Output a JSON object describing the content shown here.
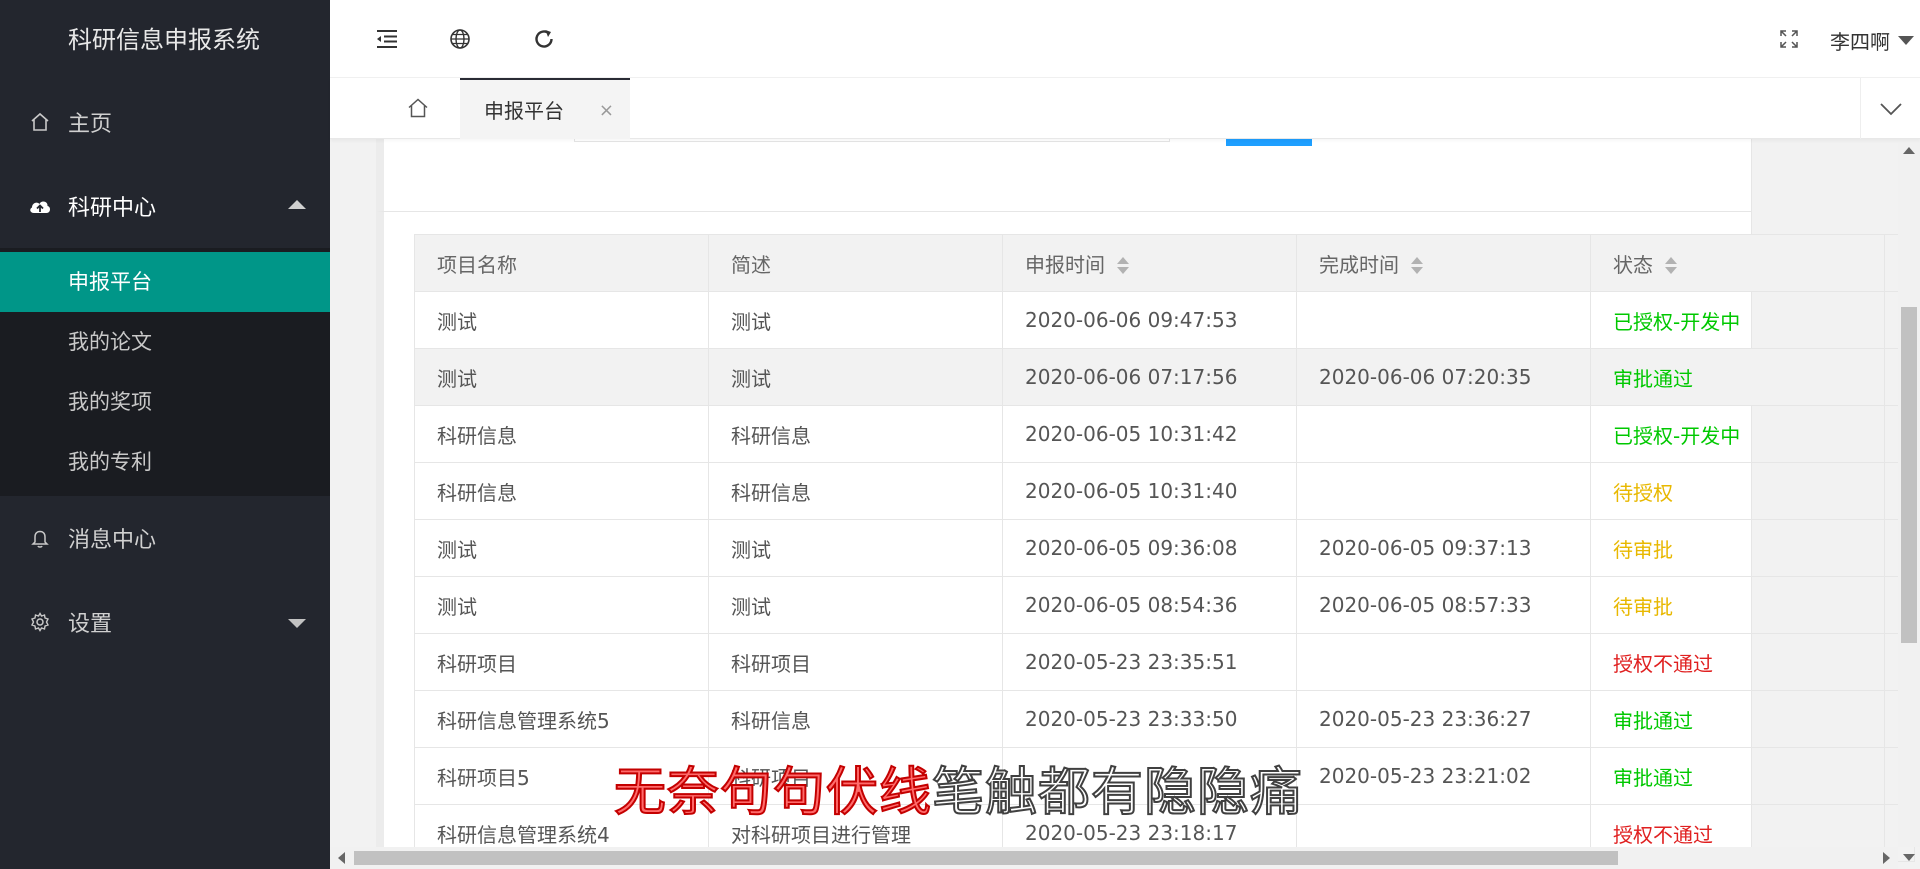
{
  "app": {
    "title": "科研信息申报系统"
  },
  "sidebar": {
    "home": "主页",
    "research": {
      "label": "科研中心",
      "items": [
        {
          "label": "申报平台"
        },
        {
          "label": "我的论文"
        },
        {
          "label": "我的奖项"
        },
        {
          "label": "我的专利"
        }
      ]
    },
    "messages": "消息中心",
    "settings": "设置"
  },
  "header": {
    "user": "李四啊",
    "icons": [
      "menu-indent-icon",
      "globe-icon",
      "refresh-icon",
      "fullscreen-icon"
    ]
  },
  "tabs": {
    "active": "申报平台",
    "close_symbol": "×"
  },
  "table": {
    "columns": [
      "项目名称",
      "简述",
      "申报时间",
      "完成时间",
      "状态"
    ],
    "sortable": [
      false,
      false,
      true,
      true,
      true
    ],
    "rows": [
      {
        "name": "测试",
        "desc": "测试",
        "submitted": "2020-06-06 09:47:53",
        "completed": "",
        "status": "已授权-开发中",
        "status_color": "#00c800"
      },
      {
        "name": "测试",
        "desc": "测试",
        "submitted": "2020-06-06 07:17:56",
        "completed": "2020-06-06 07:20:35",
        "status": "审批通过",
        "status_color": "#00c800"
      },
      {
        "name": "科研信息",
        "desc": "科研信息",
        "submitted": "2020-06-05 10:31:42",
        "completed": "",
        "status": "已授权-开发中",
        "status_color": "#00c800"
      },
      {
        "name": "科研信息",
        "desc": "科研信息",
        "submitted": "2020-06-05 10:31:40",
        "completed": "",
        "status": "待授权",
        "status_color": "#e8b800"
      },
      {
        "name": "测试",
        "desc": "测试",
        "submitted": "2020-06-05 09:36:08",
        "completed": "2020-06-05 09:37:13",
        "status": "待审批",
        "status_color": "#e8b800"
      },
      {
        "name": "测试",
        "desc": "测试",
        "submitted": "2020-06-05 08:54:36",
        "completed": "2020-06-05 08:57:33",
        "status": "待审批",
        "status_color": "#e8b800"
      },
      {
        "name": "科研项目",
        "desc": "科研项目",
        "submitted": "2020-05-23 23:35:51",
        "completed": "",
        "status": "授权不通过",
        "status_color": "#e02020"
      },
      {
        "name": "科研信息管理系统5",
        "desc": "科研信息",
        "submitted": "2020-05-23 23:33:50",
        "completed": "2020-05-23 23:36:27",
        "status": "审批通过",
        "status_color": "#00c800"
      },
      {
        "name": "科研项目5",
        "desc": "科研项目",
        "submitted": "",
        "completed": "2020-05-23 23:21:02",
        "status": "审批通过",
        "status_color": "#00c800"
      },
      {
        "name": "科研信息管理系统4",
        "desc": "对科研项目进行管理",
        "submitted": "2020-05-23 23:18:17",
        "completed": "",
        "status": "授权不通过",
        "status_color": "#e02020"
      }
    ]
  },
  "subtitle": {
    "highlighted": "无奈句句伏线",
    "rest": "笔触都有隐隐痛"
  },
  "colors": {
    "sidebar_bg": "#23262e",
    "active_item": "#009688",
    "primary_button": "#1e9fff"
  }
}
